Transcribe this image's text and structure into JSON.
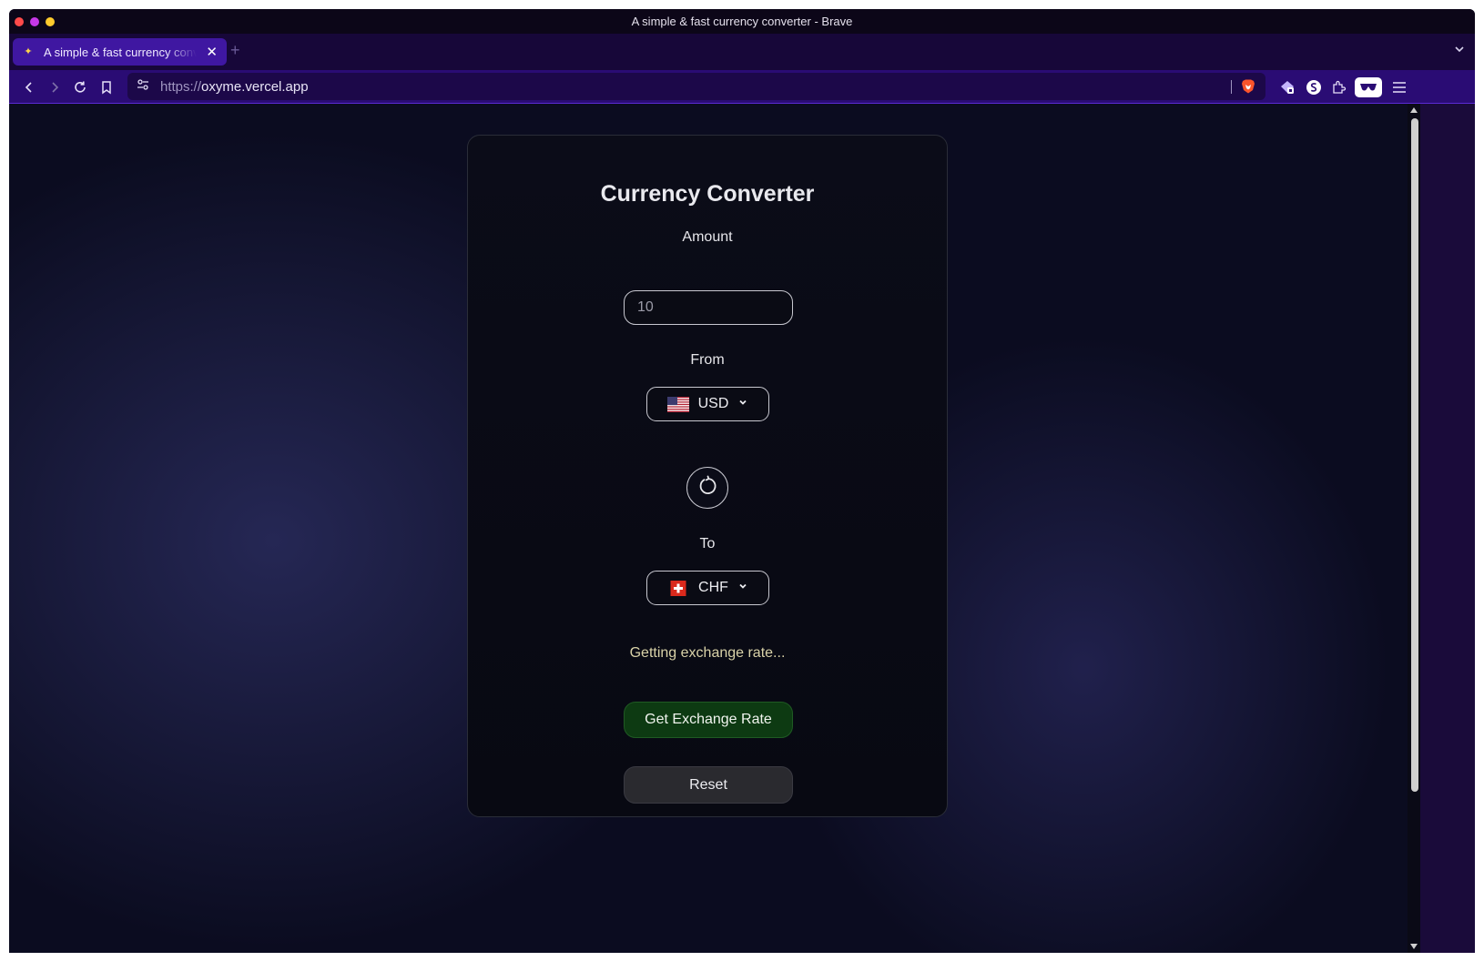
{
  "window": {
    "title": "A simple & fast currency converter - Brave"
  },
  "tabs": [
    {
      "title": "A simple & fast currency converter",
      "favicon": "sparkles-icon",
      "active": true
    }
  ],
  "toolbar": {
    "url_scheme": "https://",
    "url_host": "oxyme.vercel.app"
  },
  "converter": {
    "heading": "Currency Converter",
    "amount_label": "Amount",
    "amount_value": "10",
    "from_label": "From",
    "from_currency": "USD",
    "from_flag": "us-flag-icon",
    "to_label": "To",
    "to_currency": "CHF",
    "to_flag": "ch-flag-icon",
    "status": "Getting exchange rate...",
    "rate_button": "Get Exchange Rate",
    "reset_button": "Reset"
  },
  "colors": {
    "brave_purple": "#3f17a1",
    "rate_button_bg": "#0d3a12",
    "status_text": "#d9d2a8"
  }
}
